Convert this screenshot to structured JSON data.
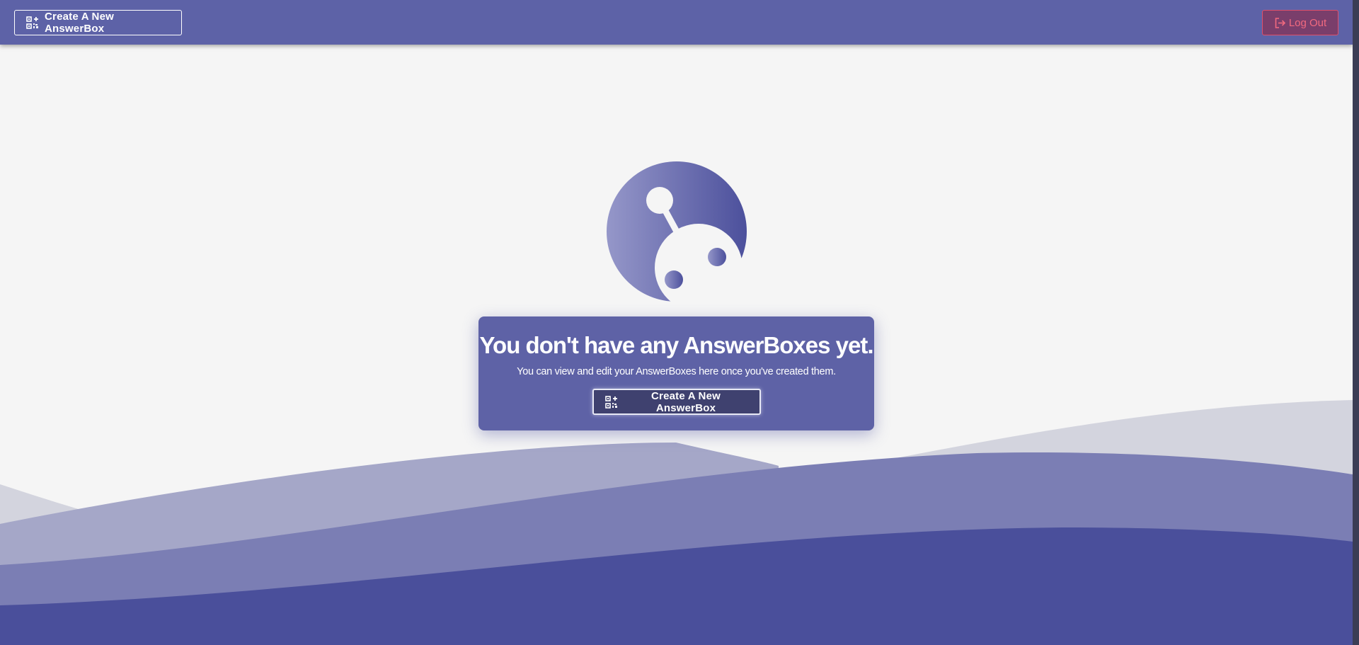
{
  "header": {
    "create_button": {
      "label": "Create A New AnswerBox",
      "icon": "qr-code-plus-icon"
    },
    "logout_button": {
      "label": "Log Out",
      "icon": "logout-icon"
    }
  },
  "empty_state": {
    "logo": "answerbox-logo",
    "title": "You don't have any AnswerBoxes yet.",
    "subtitle": "You can view and edit your AnswerBoxes here once you've created them.",
    "create_button": {
      "label": "Create A New AnswerBox",
      "icon": "qr-code-plus-icon"
    }
  },
  "colors": {
    "brand": "#5d62a7",
    "brand_dark": "#4a4f9b",
    "logout_text": "#f26a7f",
    "background": "#f5f5f5"
  }
}
